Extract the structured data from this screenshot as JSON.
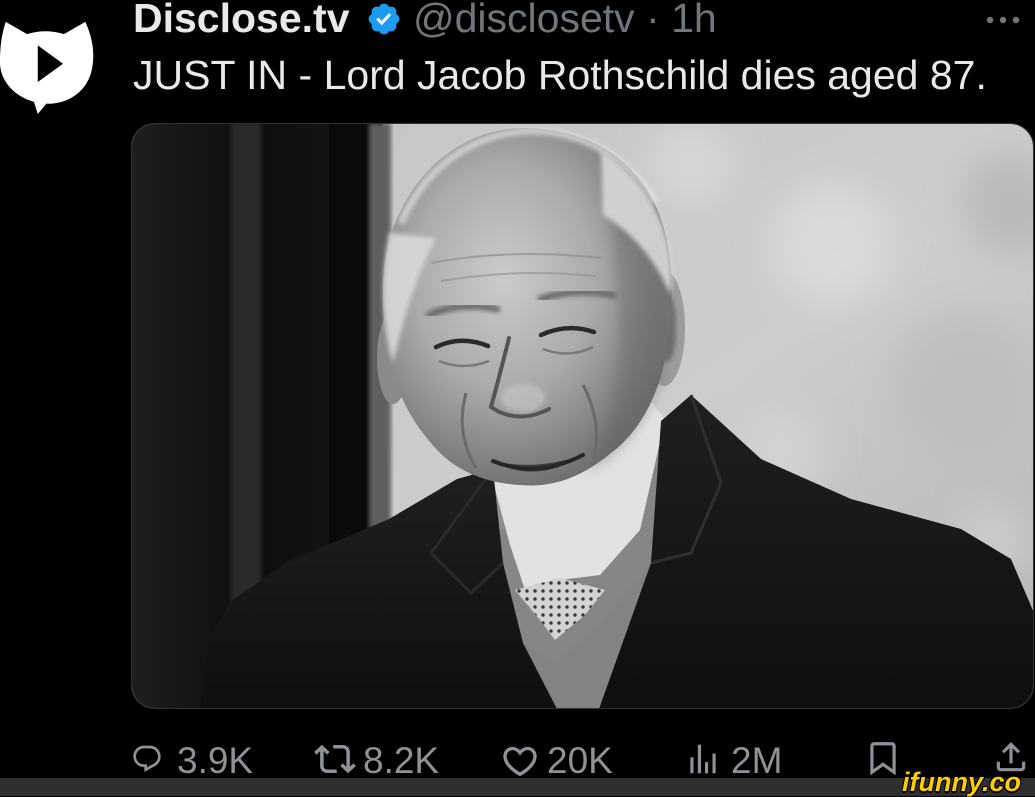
{
  "theme": {
    "background": "#000000",
    "text": "#e7e9ea",
    "secondary": "#71767b",
    "action": "#8f9397",
    "verified": "#1d9bf0",
    "media_border": "#2f3336",
    "footer_band": "#2f2f2f",
    "watermark": "#ffcc00"
  },
  "tweet": {
    "author": {
      "display_name": "Disclose.tv",
      "handle": "@disclosetv",
      "verified": true,
      "avatar_icon": "play-icon"
    },
    "separator": "·",
    "timestamp": "1h",
    "menu_icon": "more-icon",
    "text": "JUST IN - Lord Jacob Rothschild dies aged 87."
  },
  "actions": [
    {
      "icon": "reply-icon",
      "count": "3.9K"
    },
    {
      "icon": "retweet-icon",
      "count": "8.2K"
    },
    {
      "icon": "heart-icon",
      "count": "20K"
    },
    {
      "icon": "views-icon",
      "count": "2M"
    },
    {
      "icon": "bookmark-icon"
    },
    {
      "icon": "share-icon"
    }
  ],
  "watermark": {
    "text": "ifunny.co"
  }
}
